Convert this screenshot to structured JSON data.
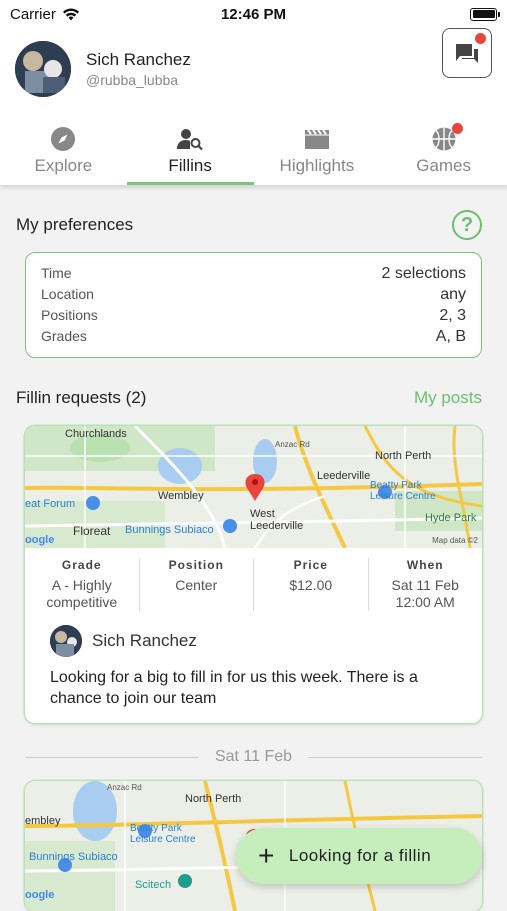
{
  "status_bar": {
    "carrier": "Carrier",
    "time": "12:46 PM"
  },
  "header": {
    "name": "Sich Ranchez",
    "handle": "@rubba_lubba"
  },
  "tabs": [
    {
      "label": "Explore",
      "icon": "compass-icon"
    },
    {
      "label": "Fillins",
      "icon": "person-search-icon"
    },
    {
      "label": "Highlights",
      "icon": "clapperboard-icon"
    },
    {
      "label": "Games",
      "icon": "basketball-icon"
    }
  ],
  "preferences": {
    "title": "My preferences",
    "rows": [
      {
        "key": "Time",
        "value": "2 selections"
      },
      {
        "key": "Location",
        "value": "any"
      },
      {
        "key": "Positions",
        "value": "2, 3"
      },
      {
        "key": "Grades",
        "value": "A, B"
      }
    ]
  },
  "requests": {
    "title": "Fillin requests (2)",
    "my_posts": "My posts",
    "card": {
      "map_labels": [
        "Churchlands",
        "North Perth",
        "Leederville",
        "Wembley",
        "Beatty Park Leisure Centre",
        "West Leederville",
        "Floreat",
        "Bunnings Subiaco",
        "Hyde Park",
        "eat Forum",
        "Anzac Rd",
        "Map data ©2",
        "oogle"
      ],
      "grade_h": "Grade",
      "grade_v": "A - Highly competitive",
      "position_h": "Position",
      "position_v": "Center",
      "price_h": "Price",
      "price_v": "$12.00",
      "when_h": "When",
      "when_v1": "Sat 11 Feb",
      "when_v2": "12:00 AM",
      "poster": "Sich Ranchez",
      "description": "Looking for a big to fill in for us this week. There is a chance to join our team"
    },
    "date_separator": "Sat 11 Feb",
    "card2": {
      "map_labels": [
        "Anzac Rd",
        "North Perth",
        "embley",
        "Beatty Park Leisure Centre",
        "Bunnings Subiaco",
        "Scitech",
        "oogle"
      ]
    }
  },
  "fab": {
    "label": "Looking for a fillin"
  },
  "colors": {
    "accent": "#6cbf6c",
    "badge": "#e8453c",
    "fab_bg": "#c5eebc"
  }
}
